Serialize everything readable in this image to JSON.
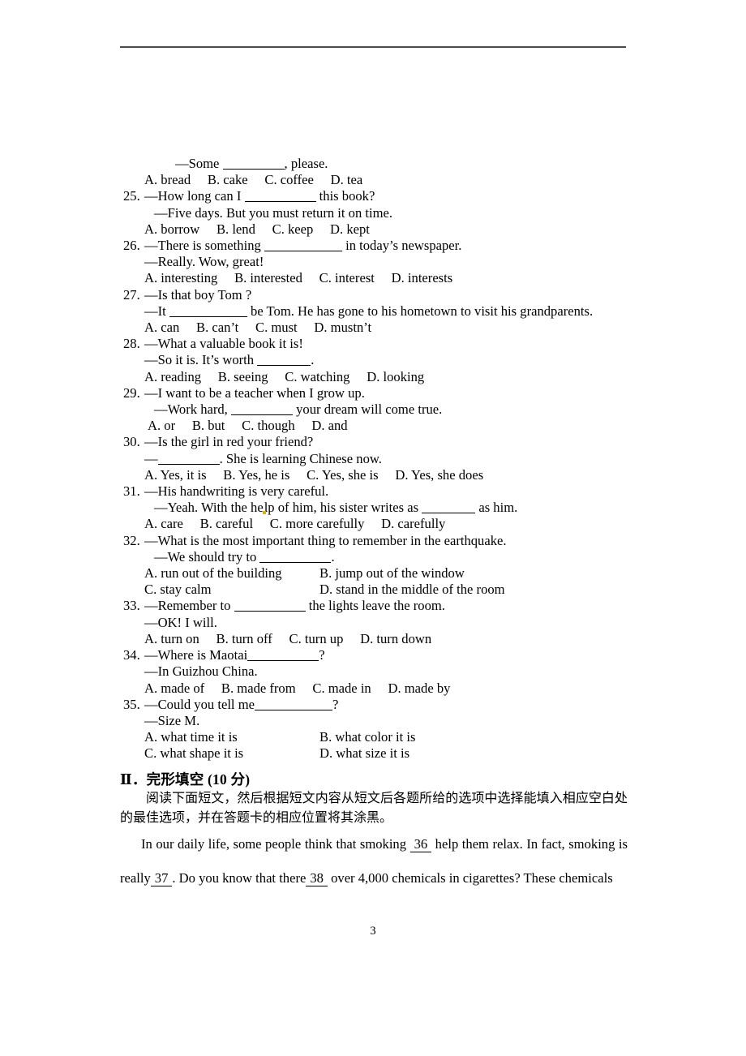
{
  "page": {
    "number": "3",
    "rule": {
      "present": true
    }
  },
  "multiple_choice": {
    "items": [
      {
        "id": "q24-tail",
        "number": "",
        "lines": [
          {
            "indent": "ind-2",
            "text_before": "—Some ",
            "blank": "b-md",
            "text_after": ", please."
          }
        ],
        "options_line": "A. bread     B. cake     C. coffee     D. tea",
        "options": [
          "A. bread",
          "B. cake",
          "C. coffee",
          "D. tea"
        ]
      },
      {
        "id": "q25",
        "number": "25.",
        "lines": [
          {
            "indent": "",
            "text_before": "—How long can I ",
            "blank": "b-lg",
            "text_after": " this book?"
          },
          {
            "indent": "ind-2",
            "text_before": "—Five days. But you must return it on time.",
            "blank": "",
            "text_after": ""
          }
        ],
        "options_line": "A. borrow     B. lend     C. keep     D. kept",
        "options": [
          "A. borrow",
          "B. lend",
          "C. keep",
          "D. kept"
        ]
      },
      {
        "id": "q26",
        "number": "26.",
        "lines": [
          {
            "indent": "",
            "text_before": "—There is something ",
            "blank": "b-xl",
            "text_after": " in today’s newspaper."
          },
          {
            "indent": "ind-1",
            "text_before": "—Really. Wow, great!",
            "blank": "",
            "text_after": ""
          }
        ],
        "options_line": "A. interesting     B. interested     C. interest     D. interests",
        "options": [
          "A. interesting",
          "B. interested",
          "C. interest",
          "D. interests"
        ]
      },
      {
        "id": "q27",
        "number": "27.",
        "lines": [
          {
            "indent": "",
            "text_before": "—Is that boy Tom ?",
            "blank": "",
            "text_after": ""
          },
          {
            "indent": "ind-1",
            "text_before": "—It ",
            "blank": "b-xl",
            "text_after": " be Tom. He has gone to his hometown to visit his grandparents."
          }
        ],
        "options_line": "A. can     B. can’t     C. must     D. mustn’t",
        "options": [
          "A. can",
          "B. can’t",
          "C. must",
          "D. mustn’t"
        ]
      },
      {
        "id": "q28",
        "number": "28.",
        "lines": [
          {
            "indent": "",
            "text_before": "—What a valuable book it is!",
            "blank": "",
            "text_after": ""
          },
          {
            "indent": "ind-1",
            "text_before": "—So it is. It’s worth ",
            "blank": "b-sm",
            "text_after": "."
          }
        ],
        "options_line": "A. reading     B. seeing     C. watching     D. looking",
        "options": [
          "A. reading",
          "B. seeing",
          "C. watching",
          "D. looking"
        ]
      },
      {
        "id": "q29",
        "number": "29.",
        "lines": [
          {
            "indent": "",
            "text_before": "—I want to be a teacher when I grow up.",
            "blank": "",
            "text_after": ""
          },
          {
            "indent": "ind-2",
            "text_before": "—Work hard, ",
            "blank": "b-md",
            "text_after": " your dream will come true."
          }
        ],
        "options_line": "A. or     B. but     C. though     D. and",
        "options": [
          "A. or",
          "B. but",
          "C. though",
          "D. and"
        ],
        "options_indent": "ind-3"
      },
      {
        "id": "q30",
        "number": "30.",
        "lines": [
          {
            "indent": "",
            "text_before": "—Is the girl in red your friend?",
            "blank": "",
            "text_after": ""
          },
          {
            "indent": "ind-1",
            "text_before": "—",
            "blank": "b-md",
            "text_after": ". She is learning Chinese now."
          }
        ],
        "options_line": "A. Yes, it is     B. Yes, he is     C. Yes, she is     D. Yes, she does",
        "options": [
          "A. Yes, it is",
          "B. Yes, he is",
          "C. Yes, she is",
          "D. Yes, she does"
        ]
      },
      {
        "id": "q31",
        "number": "31.",
        "lines": [
          {
            "indent": "",
            "text_before": "—His handwriting is very careful.",
            "blank": "",
            "text_after": ""
          },
          {
            "indent": "ind-2",
            "text_before": "—Yeah. With the help of him, his sister writes as ",
            "blank": "b-sm",
            "text_after": " as him.",
            "artifact": true
          }
        ],
        "options_line": "A. care     B. careful     C. more carefully     D. carefully",
        "options": [
          "A. care",
          "B. careful",
          "C. more carefully",
          "D. carefully"
        ]
      },
      {
        "id": "q32",
        "number": "32.",
        "lines": [
          {
            "indent": "",
            "text_before": "—What is the most important thing to remember in the earthquake.",
            "blank": "",
            "text_after": ""
          },
          {
            "indent": "ind-2",
            "text_before": "—We should try to ",
            "blank": "b-lg",
            "text_after": "."
          }
        ],
        "options_grid": [
          [
            "A. run out of the building",
            "B. jump out of the window"
          ],
          [
            "C. stay calm",
            "D. stand in the middle of the room"
          ]
        ]
      },
      {
        "id": "q33",
        "number": "33.",
        "lines": [
          {
            "indent": "",
            "text_before": "—Remember to ",
            "blank": "b-lg",
            "text_after": " the lights leave the room."
          },
          {
            "indent": "ind-1",
            "text_before": "—OK! I will.",
            "blank": "",
            "text_after": ""
          }
        ],
        "options_line": "A. turn on     B. turn off     C. turn up     D. turn down",
        "options": [
          "A. turn on",
          "B. turn off",
          "C. turn up",
          "D. turn down"
        ]
      },
      {
        "id": "q34",
        "number": "34.",
        "lines": [
          {
            "indent": "",
            "text_before": "—Where is Maotai",
            "blank": "b-lg",
            "text_after": "?"
          },
          {
            "indent": "ind-1",
            "text_before": "—In Guizhou China.",
            "blank": "",
            "text_after": ""
          }
        ],
        "options_line": "A. made of     B. made from     C. made in     D. made by",
        "options": [
          "A. made of",
          "B. made from",
          "C. made in",
          "D. made by"
        ]
      },
      {
        "id": "q35",
        "number": "35.",
        "lines": [
          {
            "indent": "",
            "text_before": "—Could you tell me",
            "blank": "b-xl",
            "text_after": "?"
          },
          {
            "indent": "ind-1",
            "text_before": "—Size M.",
            "blank": "",
            "text_after": ""
          }
        ],
        "options_grid": [
          [
            "A. what time it is",
            "B. what color it is"
          ],
          [
            "C. what shape it is",
            "D. what size it is"
          ]
        ]
      }
    ]
  },
  "section_two": {
    "heading": "Ⅱ．完形填空 (10 分)",
    "instructions": "阅读下面短文，然后根据短文内容从短文后各题所给的选项中选择能填入相应空白处的最佳选项，并在答题卡的相应位置将其涂黑。",
    "passage": {
      "segments": [
        {
          "type": "text",
          "value": "In our daily life, some people think that smoking "
        },
        {
          "type": "blank",
          "value": "36"
        },
        {
          "type": "text",
          "value": " help them relax. In fact, smoking is really"
        },
        {
          "type": "blank",
          "value": "37"
        },
        {
          "type": "text",
          "value": ". Do you know that there"
        },
        {
          "type": "blank",
          "value": "38"
        },
        {
          "type": "text",
          "value": " over 4,000 chemicals in cigarettes? These chemicals"
        }
      ]
    }
  }
}
